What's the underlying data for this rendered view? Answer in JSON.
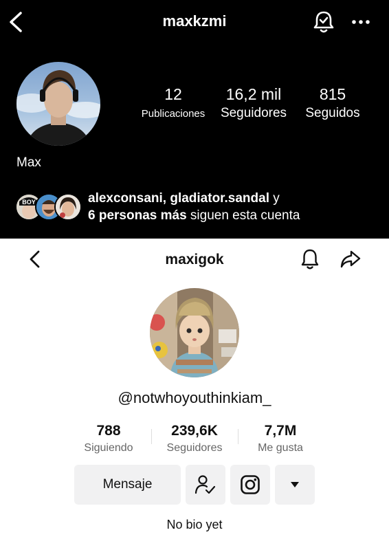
{
  "instagram": {
    "username": "maxkzmi",
    "name": "Max",
    "stats": [
      {
        "num": "12",
        "label": "Publicaciones"
      },
      {
        "num": "16,2 mil",
        "label": "Seguidores"
      },
      {
        "num": "815",
        "label": "Seguidos"
      }
    ],
    "followed_by": {
      "names": "alexconsani, gladiator.sandal",
      "connector": " y",
      "more": "6 personas más",
      "suffix": " siguen esta cuenta"
    },
    "mini_avatar_text": "BOY"
  },
  "tiktok": {
    "username": "maxigok",
    "handle": "@notwhoyouthinkiam_",
    "stats": [
      {
        "num": "788",
        "label": "Siguiendo"
      },
      {
        "num": "239,6K",
        "label": "Seguidores"
      },
      {
        "num": "7,7M",
        "label": "Me gusta"
      }
    ],
    "message_label": "Mensaje",
    "bio": "No bio yet"
  },
  "icons": [
    "back-icon",
    "bell-check-icon",
    "more-icon",
    "bell-icon",
    "share-icon",
    "user-check-icon",
    "instagram-icon",
    "caret-down-icon"
  ]
}
